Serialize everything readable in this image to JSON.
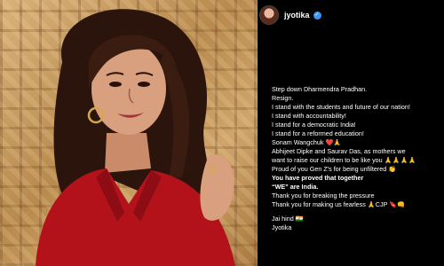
{
  "post": {
    "username": "jyotika",
    "caption_lines": [
      {
        "text": "Step down Dharmendra Pradhan.",
        "bold": false
      },
      {
        "text": "Resign.",
        "bold": false
      },
      {
        "text": "I stand with the students and future of our nation!",
        "bold": false
      },
      {
        "text": "I stand with accountability!",
        "bold": false
      },
      {
        "text": "I stand for a democratic India!",
        "bold": false
      },
      {
        "text": "I stand for a reformed education!",
        "bold": false
      },
      {
        "text": "Sonam Wangchuk ❤️🙏",
        "bold": false
      },
      {
        "text": "Abhijeet Dipke and Saurav Das, as mothers we",
        "bold": false
      },
      {
        "text": "want to raise our children to be like you 🙏🙏🙏🙏",
        "bold": false
      },
      {
        "text": "Proud of you Gen Z's for being unfiltered 👏",
        "bold": false
      },
      {
        "text": "You have proved that together",
        "bold": true
      },
      {
        "text": "“WE” are India.",
        "bold": true
      },
      {
        "text": "Thank you for breaking the pressure",
        "bold": false
      },
      {
        "text": "Thank you for making us fearless 🙏CJP 🔖👊",
        "bold": false
      }
    ],
    "signoff": [
      "Jai hind 🇮🇳",
      "Jyotika"
    ]
  },
  "colors": {
    "background": "#000000",
    "verified": "#3897f0",
    "shirt": "#b3121b"
  }
}
